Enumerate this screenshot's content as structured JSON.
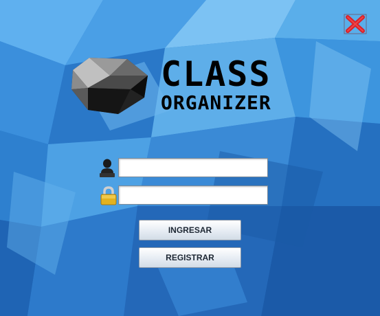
{
  "window": {
    "close_icon": "close-icon"
  },
  "logo": {
    "line1": "CLASS",
    "line2": "ORGANIZER",
    "icon": "gem-icon"
  },
  "login": {
    "user_icon": "user-icon",
    "lock_icon": "lock-icon",
    "username_value": "",
    "password_value": ""
  },
  "buttons": {
    "ingresar": "INGRESAR",
    "registrar": "REGISTRAR"
  },
  "colors": {
    "background": "#2f7fd0",
    "close_red": "#d9222a",
    "button_text": "#1d2733"
  }
}
